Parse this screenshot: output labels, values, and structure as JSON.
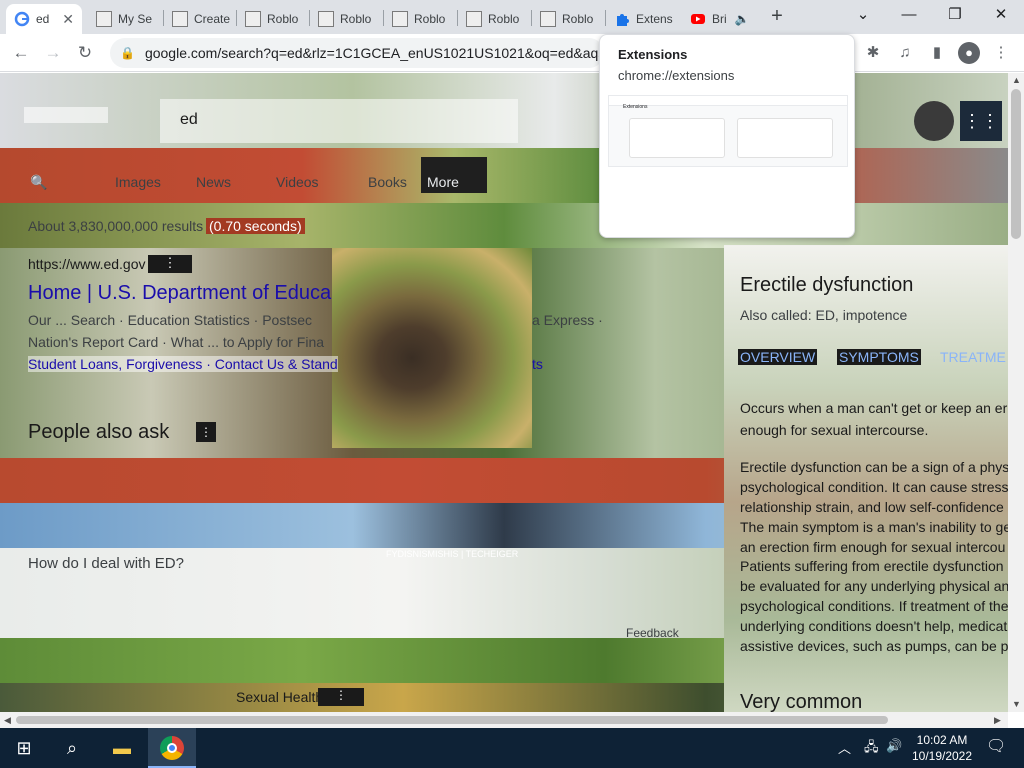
{
  "browser": {
    "tabs": [
      {
        "label": "ed",
        "icon": "google-g-icon",
        "active": true
      },
      {
        "label": "My Se",
        "icon": "page-icon"
      },
      {
        "label": "Create",
        "icon": "page-icon"
      },
      {
        "label": "Roblo",
        "icon": "page-icon"
      },
      {
        "label": "Roblo",
        "icon": "page-icon"
      },
      {
        "label": "Roblo",
        "icon": "page-icon"
      },
      {
        "label": "Roblo",
        "icon": "page-icon"
      },
      {
        "label": "Roblo",
        "icon": "page-icon"
      },
      {
        "label": "Extens",
        "icon": "puzzle-icon"
      },
      {
        "label": "Bri",
        "icon": "youtube-icon"
      }
    ],
    "close_glyph": "✕",
    "new_tab_glyph": "+",
    "url": "google.com/search?q=ed&rlz=1C1GCEA_enUS1021US1021&oq=ed&aqs="
  },
  "popup": {
    "title": "Extensions",
    "url": "chrome://extensions",
    "thumb_title": "Extensions"
  },
  "page": {
    "search_query": "ed",
    "tabs": [
      "Images",
      "News",
      "Videos",
      "Books",
      "More"
    ],
    "result_stats": "About 3,830,000,000 results",
    "result_time": "(0.70 seconds)",
    "result_url": "https://www.ed.gov",
    "result_title": "Home | U.S. Department of Educa",
    "result_snippet_1": "Our ... Search · Education Statistics · Postsec",
    "result_snippet_1b": "a Express ·",
    "result_snippet_2": "Nation's Report Card · What ... to Apply for Fina",
    "sitelinks": "Student Loans, Forgiveness · Contact Us & Stand",
    "sitelinks_end": "ts",
    "paa_heading": "People also ask",
    "paa_q": "How do I deal with ED?",
    "feedback": "Feedback",
    "bottom_item": "Sexual Health",
    "kp_title": "Erectile dysfunction",
    "kp_also": "Also called: ED, impotence",
    "kp_tabs": [
      "OVERVIEW",
      "SYMPTOMS",
      "TREATME"
    ],
    "kp_def_1": "Occurs when a man can't get or keep an er",
    "kp_def_2": "enough for sexual intercourse.",
    "kp_p1_1": "Erectile dysfunction can be a sign of a phys",
    "kp_p1_2": "psychological condition. It can cause stress",
    "kp_p1_3": "relationship strain, and low self-confidence",
    "kp_p1_4": "The main symptom is a man's inability to ge",
    "kp_p1_5": "an erection firm enough for sexual intercou",
    "kp_p2_1": "Patients suffering from erectile dysfunction",
    "kp_p2_2": "be evaluated for any underlying physical an",
    "kp_p2_3": "psychological conditions. If treatment of the",
    "kp_p2_4": "underlying conditions doesn't help, medicat",
    "kp_p2_5": "assistive devices, such as pumps, can be p",
    "kp_footer": "Very common",
    "overlay_text": "FYDISNISMISHIS | TECHEIGER"
  },
  "taskbar": {
    "time": "10:02 AM",
    "date": "10/19/2022"
  }
}
